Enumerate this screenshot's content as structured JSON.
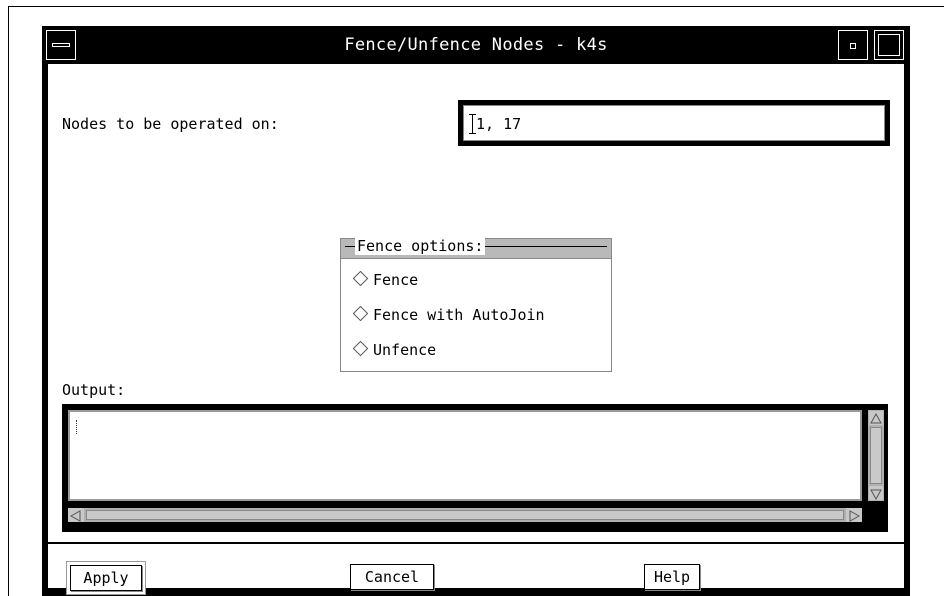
{
  "window": {
    "title": "Fence/Unfence Nodes - k4s"
  },
  "nodes": {
    "label": "Nodes to be operated on:",
    "value": "1, 17"
  },
  "fence_options": {
    "title": "Fence options:",
    "items": [
      {
        "label": "Fence"
      },
      {
        "label": "Fence with AutoJoin"
      },
      {
        "label": "Unfence"
      }
    ]
  },
  "output": {
    "label": "Output:",
    "value": ""
  },
  "buttons": {
    "apply": "Apply",
    "cancel": "Cancel",
    "help": "Help"
  }
}
